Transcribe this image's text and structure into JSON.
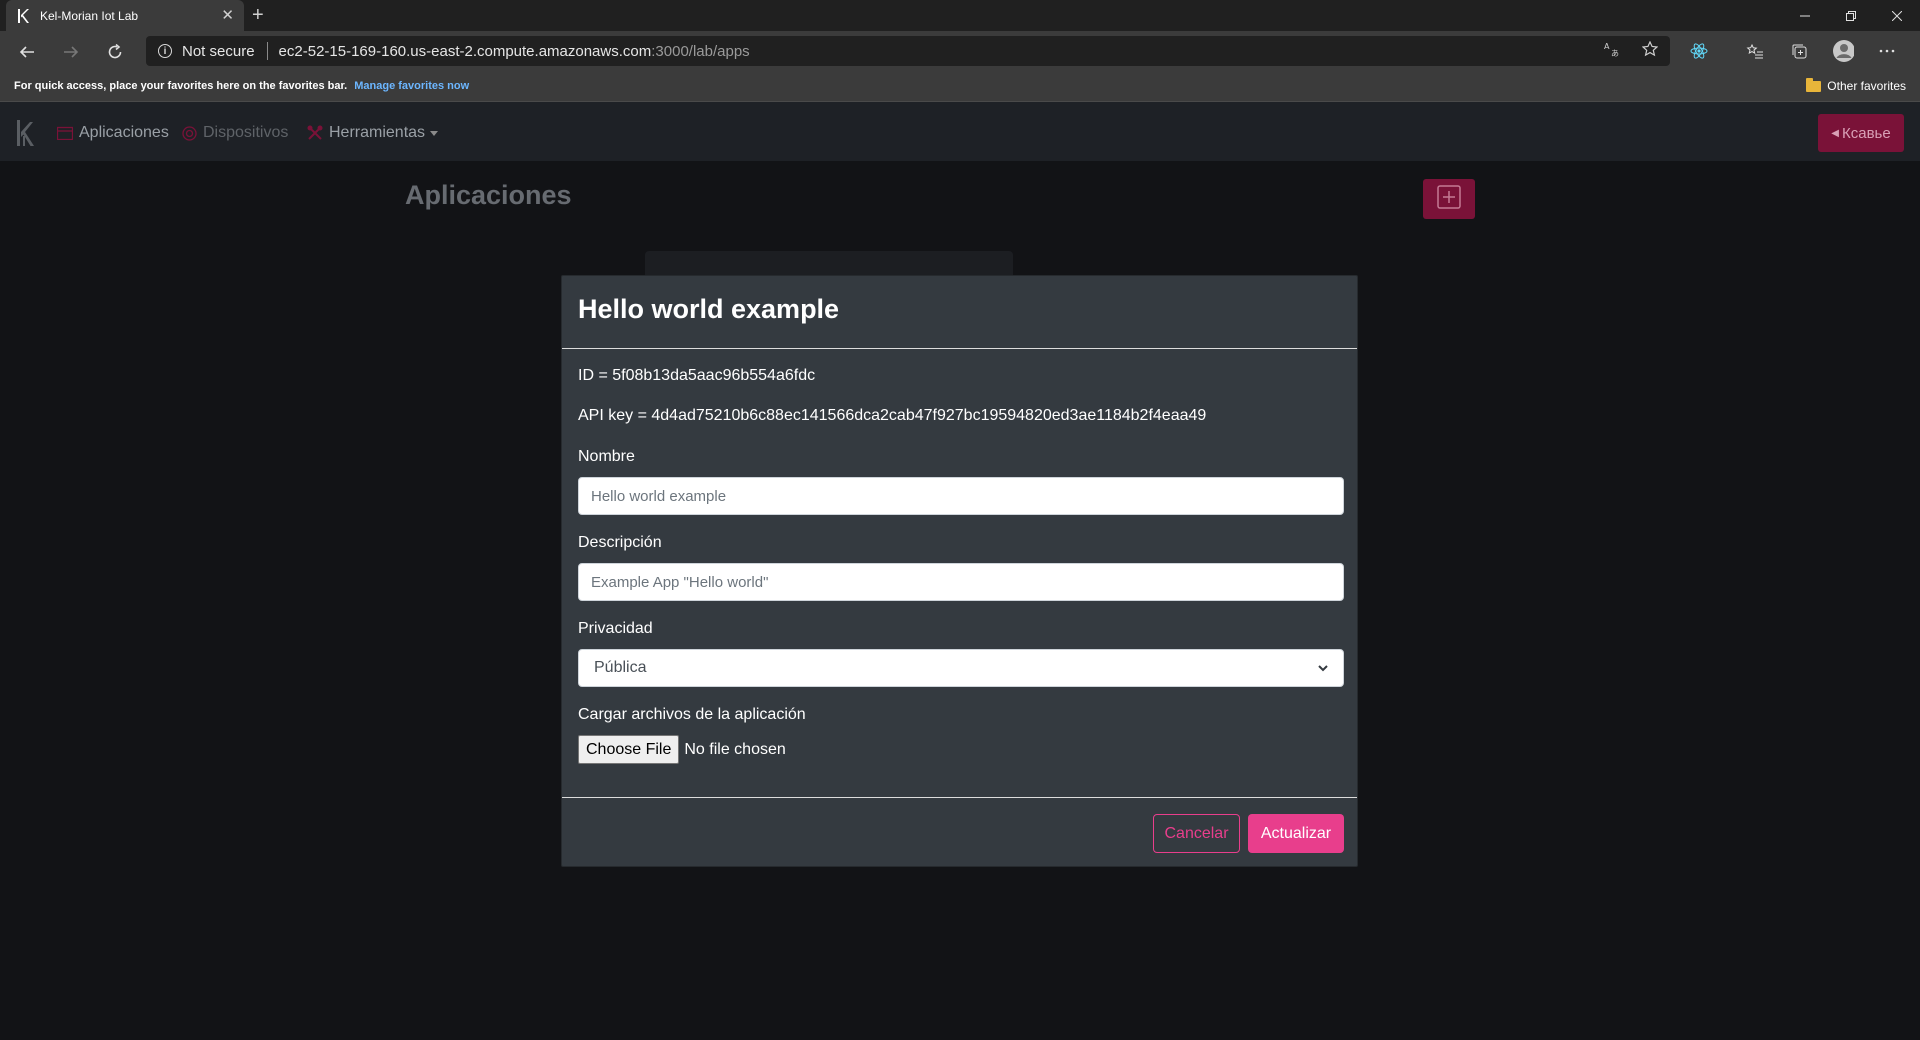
{
  "browser": {
    "tab_title": "Kel-Morian Iot Lab",
    "new_tab": "+",
    "security_label": "Not secure",
    "url_host": "ec2-52-15-169-160.us-east-2.compute.amazonaws.com",
    "url_path": ":3000/lab/apps",
    "favorites_prompt": "For quick access, place your favorites here on the favorites bar.",
    "favorites_link": "Manage favorites now",
    "other_favorites": "Other favorites"
  },
  "app": {
    "nav": {
      "apps": "Aplicaciones",
      "devices": "Dispositivos",
      "tools": "Herramientas",
      "logout": "Ксавье"
    },
    "page_title": "Aplicaciones",
    "colors": {
      "accent": "#e83e8c",
      "accent_dim": "#7a1238",
      "modal_bg": "#343a40",
      "page_bg": "#121316"
    }
  },
  "modal": {
    "title": "Hello world example",
    "id_line": "ID = 5f08b13da5aac96b554a6fdc",
    "api_line": "API key = 4d4ad75210b6c88ec141566dca2cab47f927bc19594820ed3ae1184b2f4eaa49",
    "name_label": "Nombre",
    "name_placeholder": "Hello world example",
    "desc_label": "Descripción",
    "desc_placeholder": "Example App \"Hello world\"",
    "privacy_label": "Privacidad",
    "privacy_value": "Pública",
    "upload_label": "Cargar archivos de la aplicación",
    "file_button": "Choose File",
    "file_status": "No file chosen",
    "cancel": "Cancelar",
    "submit": "Actualizar"
  }
}
